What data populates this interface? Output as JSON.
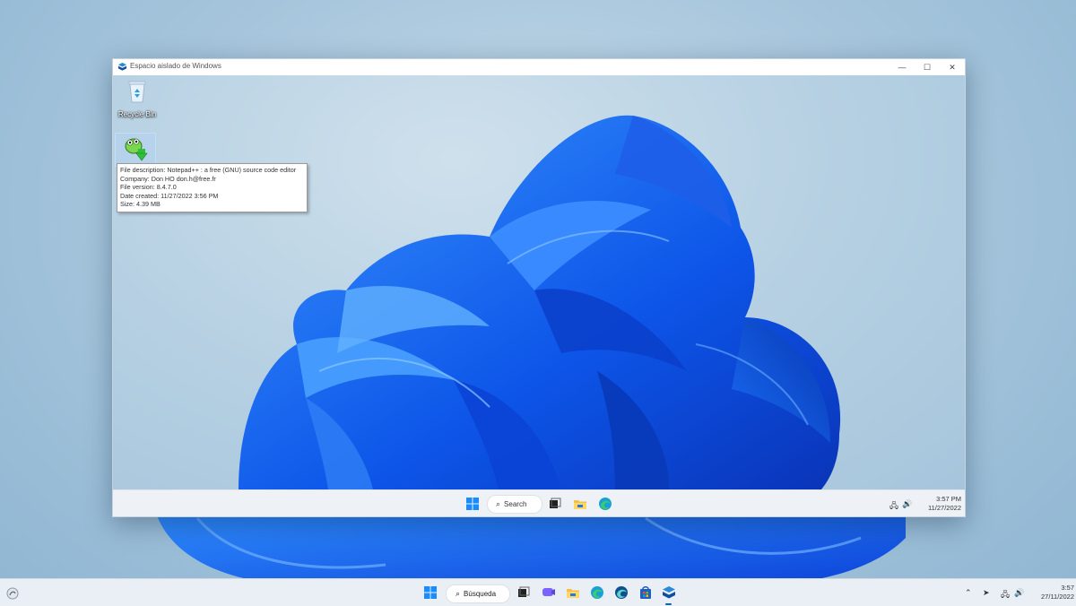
{
  "sandbox_window": {
    "title": "Espacio aislado de Windows",
    "controls": {
      "minimize": "—",
      "maximize": "☐",
      "close": "✕"
    }
  },
  "guest_desktop": {
    "icons": [
      {
        "name": "recycle-bin",
        "label": "Recycle Bin"
      }
    ],
    "tooltip": {
      "description": "File description: Notepad++ : a free (GNU) source code editor",
      "company": "Company: Don HO don.h@free.fr",
      "version": "File version: 8.4.7.0",
      "created": "Date created: 11/27/2022 3:56 PM",
      "size": "Size: 4.39 MB"
    }
  },
  "guest_taskbar": {
    "search_label": "Search",
    "time": "3:57 PM",
    "date": "11/27/2022",
    "pinned": [
      "start-icon",
      "search",
      "task-view-icon",
      "file-explorer-icon",
      "edge-icon"
    ]
  },
  "host_taskbar": {
    "search_label": "Búsqueda",
    "time": "3:57",
    "date": "27/11/2022",
    "pinned": [
      "start-icon",
      "search",
      "task-view-icon",
      "teams-chat-icon",
      "file-explorer-icon",
      "edge-icon",
      "edge-dev-icon",
      "store-icon",
      "sandbox-icon"
    ]
  },
  "colors": {
    "accent": "#0067c0",
    "bloom_dark": "#0a3fd6",
    "bloom_light": "#2f8cff"
  }
}
